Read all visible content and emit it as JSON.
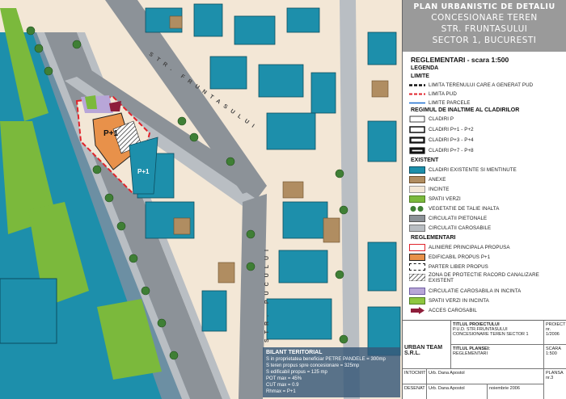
{
  "title": {
    "line1": "PLAN URBANISTIC DE DETALIU",
    "line2": "CONCESIONARE TEREN",
    "line3": "STR. FRUNTASULUI",
    "line4": "SECTOR 1, BUCURESTI"
  },
  "legend": {
    "title": "REGLEMENTARI - scara 1:500",
    "subtitle": "LEGENDA",
    "sections": {
      "limite": "LIMITE",
      "regim": "REGIMUL DE INALTIME AL CLADIRILOR",
      "existent": "EXISTENT",
      "reglementari": "REGLEMENTARI"
    },
    "items": [
      {
        "label": "LIMITA TERENULUI CARE A GENERAT PUD",
        "symbol": "dash-black"
      },
      {
        "label": "LIMITA PUD",
        "symbol": "dash-red"
      },
      {
        "label": "LIMITE PARCELE",
        "symbol": "line-blue"
      },
      {
        "label": "CLADIRI P",
        "symbol": "box-thin"
      },
      {
        "label": "CLADIRI P+1 - P+2",
        "symbol": "box-med"
      },
      {
        "label": "CLADIRI P+3 - P+4",
        "symbol": "box-thick"
      },
      {
        "label": "CLADIRI P+7 - P+8",
        "symbol": "box-heavy"
      },
      {
        "label": "CLADIRI EXISTENTE SI MENTINUTE",
        "symbol": "fill-teal"
      },
      {
        "label": "ANEXE",
        "symbol": "fill-brown"
      },
      {
        "label": "INCINTE",
        "symbol": "fill-beige"
      },
      {
        "label": "SPATII VERZI",
        "symbol": "fill-green"
      },
      {
        "label": "VEGETATIE DE TALIE INALTA",
        "symbol": "trees"
      },
      {
        "label": "CIRCULATII PIETONALE",
        "symbol": "fill-grey"
      },
      {
        "label": "CIRCULATII CAROSABILE",
        "symbol": "fill-lightgrey"
      },
      {
        "label": "ALINIERE PRINCIPALA PROPUSA",
        "symbol": "outline-red"
      },
      {
        "label": "EDIFICABIL PROPUS P+1",
        "symbol": "fill-orange"
      },
      {
        "label": "PARTER LIBER PROPUS",
        "symbol": "dash-box"
      },
      {
        "label": "ZONA DE PROTECTIE RACORD CANALIZARE EXISTENT",
        "symbol": "hatch"
      },
      {
        "label": "CIRCULATIE CAROSABILA IN INCINTA",
        "symbol": "fill-lavender"
      },
      {
        "label": "SPATII VERZI IN INCINTA",
        "symbol": "fill-green2"
      },
      {
        "label": "ACCES CAROSABIL",
        "symbol": "arrow"
      }
    ]
  },
  "map": {
    "labels": {
      "p1_main": "P+1",
      "p1_second": "P+1",
      "street_fruntasului": "STR. FRUNTASULUI",
      "street_pucului": "STR. PUCULUI"
    },
    "colors": {
      "building": "#1d8fab",
      "annex": "#b08d61",
      "plot": "#f3e7d6",
      "green": "#7bb93c",
      "road": "#8c9298",
      "sidewalk": "#b9bec3",
      "proposed": "#e8914a",
      "pud_limit": "#e0232b"
    }
  },
  "bilant": {
    "heading": "BILANT TERITORIAL",
    "lines": [
      "S in proprietatea beneficiar PETRE PANDELE = 300mp",
      "S teren propus spre concesionare = 325mp",
      "S edificabil propus = 125 mp",
      "POT max = 45%",
      "CUT max = 0.9",
      "Rhmax = P+1"
    ]
  },
  "cartouche": {
    "company": "URBAN TEAM S.R.L.",
    "project_title_label": "TITLUL PROIECTULUI",
    "project_title": "P.U.D. STR.FRUNTASULUI CONCESIONARE TEREN SECTOR 1",
    "project_label": "PROIECT nr.",
    "project_no": "1/2006",
    "intocmit_label": "INTOCMIT",
    "intocmit_name": "Urb. Dana Apostol",
    "desenat_label": "DESENAT",
    "desenat_name": "Urb. Dana Apostol",
    "plansa_title_label": "TITLUL PLANSEI:",
    "plansa_title": "REGLEMENTARI",
    "scara_label": "SCARA",
    "scara": "1:500",
    "date": "noiembrie 2006",
    "plansa_label": "PLANSA",
    "plansa_no": "nr.3"
  }
}
